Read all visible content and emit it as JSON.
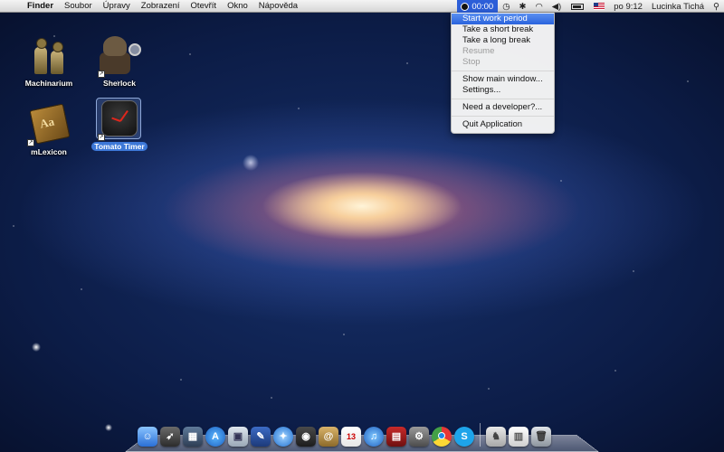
{
  "menubar": {
    "apple_glyph": "",
    "app_name": "Finder",
    "menus": [
      "Soubor",
      "Úpravy",
      "Zobrazení",
      "Otevřít",
      "Okno",
      "Nápověda"
    ],
    "timer_value": "00:00",
    "clock": "po 9:12",
    "user": "Lucinka Tichá"
  },
  "dropdown": {
    "group1": [
      "Start work period",
      "Take a short break",
      "Take a long break"
    ],
    "disabled": [
      "Resume",
      "Stop"
    ],
    "group2": [
      "Show main window...",
      "Settings..."
    ],
    "group3": [
      "Need a developer?..."
    ],
    "group4": [
      "Quit Application"
    ]
  },
  "desktop": {
    "icons": [
      {
        "label": "Machinarium"
      },
      {
        "label": "Sherlock"
      },
      {
        "label": "mLexicon"
      },
      {
        "label": "Tomato Timer"
      }
    ],
    "lexicon_glyph": "Aa"
  },
  "dock": {
    "calendar_day": "13"
  },
  "colors": {
    "menu_highlight": "#2a63dd",
    "selection": "#3d78d8"
  }
}
